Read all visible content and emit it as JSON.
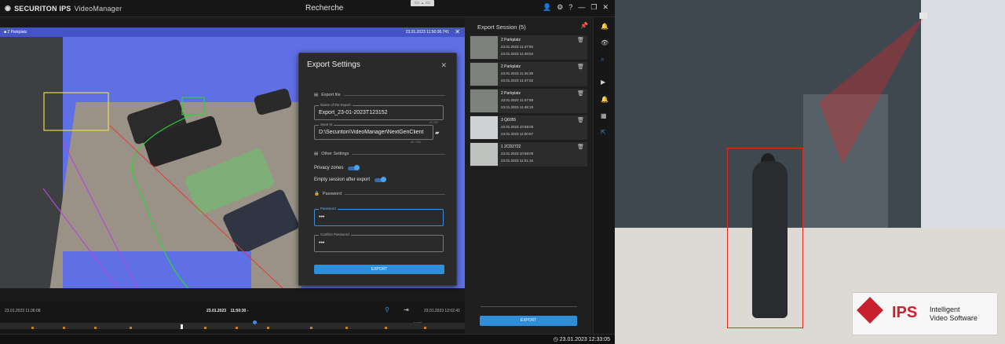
{
  "app": {
    "brand": "SECURITON IPS",
    "product": "VideoManager",
    "title": "Recherche"
  },
  "camera": {
    "label": "2 Parkplatz",
    "timestamp": "23.01.2023 11:50:30.741"
  },
  "export_dialog": {
    "title": "Export Settings",
    "export_file_section": "Export file",
    "name_label": "Name of the Export",
    "name_value": "Export_23-01-2023T123152",
    "name_counter": "24 / 50",
    "save_label": "Save to",
    "save_value": "D:\\Securiton\\VideoManager\\NextGenClient",
    "save_counter": "40 / 255",
    "other_section": "Other Settings",
    "privacy_label": "Privacy zones",
    "empty_label": "Empty session after export",
    "password_section": "Password",
    "password_label": "Password",
    "password_value": "•••",
    "confirm_label": "Confirm Password",
    "confirm_value": "•••",
    "export_button": "EXPORT"
  },
  "export_session": {
    "title": "Export Session (5)",
    "items": [
      {
        "name": "2 Parkplatz",
        "start": "23.01.2023 11:47:50",
        "end": "23.01.2023 11:48:04"
      },
      {
        "name": "2 Parkplatz",
        "start": "23.01.2023 11:46:38",
        "end": "23.01.2023 11:47:02"
      },
      {
        "name": "2 Parkplatz",
        "start": "23.01.2023 11:47:58",
        "end": "23.01.2023 11:48:19"
      },
      {
        "name": "3 Q6055",
        "start": "23.01.2023 10:58:00",
        "end": "23.01.2023 11:00:57"
      },
      {
        "name": "1 2CD2722",
        "start": "23.01.2023 10:58:00",
        "end": "23.01.2023 11:01:16"
      }
    ],
    "export_button": "EXPORT"
  },
  "timeline": {
    "left_time": "23.01.2023 11:36:08",
    "center_date": "23.01.2023",
    "center_time": "11:50:30 -",
    "right_time": "23.01.2023 12:02:41",
    "tick_label": "12:00"
  },
  "status_clock": "23.01.2023 12:33:05",
  "ips_logo": {
    "mark": "IPS",
    "line1": "Intelligent",
    "line2": "Video Software"
  },
  "colors": {
    "accent": "#2f8ed8",
    "mask": "#5f6fe6",
    "bbox": "#e02a2a",
    "brand_red": "#c8202f"
  }
}
